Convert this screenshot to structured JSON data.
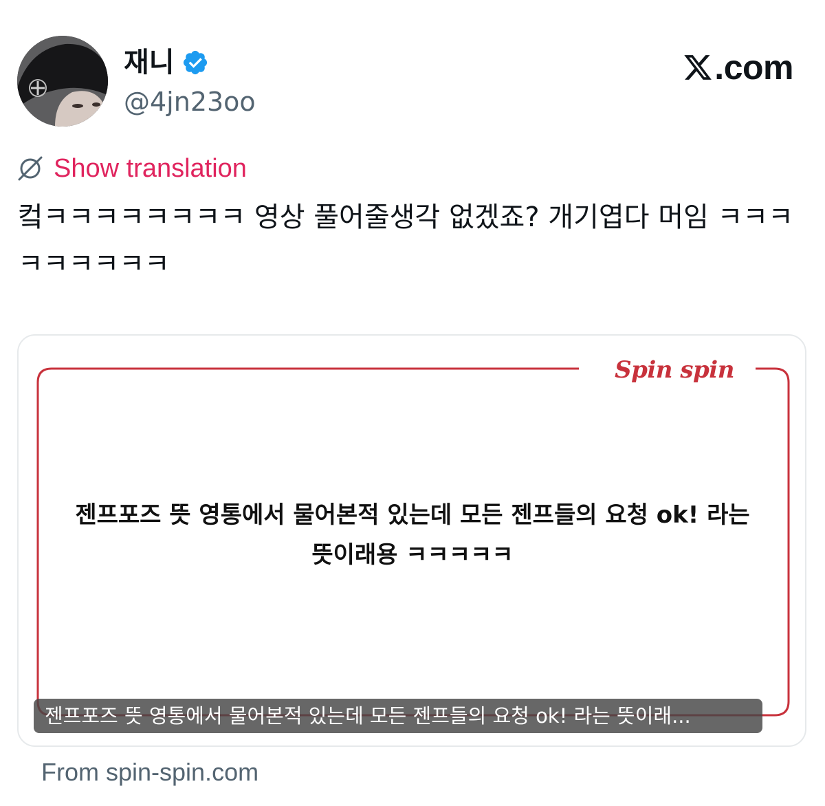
{
  "author": {
    "display_name": "재니",
    "handle": "@4jn23oo",
    "verified": true,
    "avatar_icon": "profile-photo"
  },
  "brand": {
    "logo_icon": "x-logo",
    "text": ".com"
  },
  "translate": {
    "icon": "globe-icon",
    "label": "Show translation",
    "color": "#e0245e"
  },
  "tweet": {
    "text": "컼ㅋㅋㅋㅋㅋㅋㅋㅋ 영상 풀어줄생각 없겠죠? 개기엽다 머임 ㅋㅋㅋㅋㅋㅋㅋㅋㅋ"
  },
  "card": {
    "logo_text": "Spin spin",
    "body_text": "젠프포즈 뜻 영통에서 물어본적 있는데 모든 젠프들의 요청 ok! 라는 뜻이래용 ㅋㅋㅋㅋㅋ",
    "caption": "젠프포즈 뜻 영통에서 물어본적 있는데 모든 젠프들의 요청 ok! 라는 뜻이래...",
    "source": "From spin-spin.com",
    "frame_color": "#c8323c"
  },
  "colors": {
    "text_primary": "#0f1419",
    "text_secondary": "#536471",
    "verified_blue": "#1d9bf0"
  }
}
